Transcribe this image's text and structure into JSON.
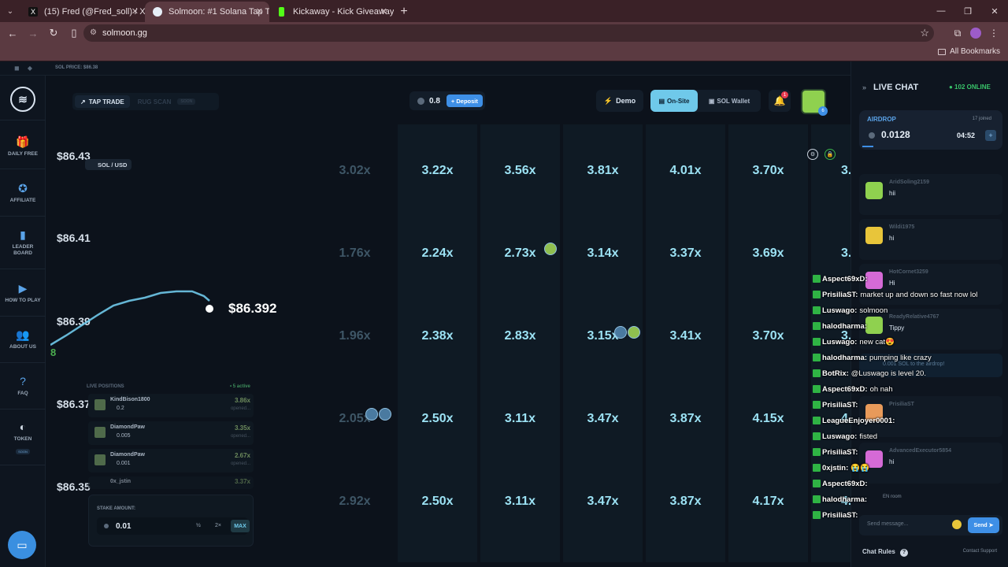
{
  "browser": {
    "tabs": [
      {
        "title": "(15) Fred (@Fred_soll) / X",
        "active": false,
        "icon": "x-icon"
      },
      {
        "title": "Solmoon: #1 Solana Tap Trading",
        "active": true,
        "icon": "solmoon-icon"
      },
      {
        "title": "Kickaway - Kick Giveaway Tool",
        "active": false,
        "icon": "kick-icon"
      }
    ],
    "url": "solmoon.gg",
    "bookmarks_label": "All Bookmarks"
  },
  "site": {
    "sol_price_text": "SOL PRICE: $86.38",
    "sidebar": [
      {
        "label": "DAILY FREE",
        "icon": "gift-icon"
      },
      {
        "label": "AFFILIATE",
        "icon": "affiliate-icon"
      },
      {
        "label": "LEADER BOARD",
        "icon": "leaderboard-icon"
      },
      {
        "label": "HOW TO PLAY",
        "icon": "play-icon"
      },
      {
        "label": "ABOUT US",
        "icon": "users-icon"
      },
      {
        "label": "FAQ",
        "icon": "question-icon"
      },
      {
        "label": "TOKEN",
        "icon": "token-icon",
        "badge": "SOON"
      }
    ],
    "header": {
      "tap_trade": "TAP TRADE",
      "rug_scan": "RUG SCAN",
      "rug_badge": "SOON",
      "balance": "0.8",
      "deposit": "+ Deposit",
      "demo": "Demo",
      "on_site": "On-Site",
      "sol_wallet": "SOL Wallet",
      "notif_count": "1",
      "user_level": "6"
    },
    "chart": {
      "pair": "SOL / USD",
      "price_labels": [
        "$86.43",
        "$86.41",
        "$86.39",
        "$86.37",
        "$86.35"
      ],
      "current_price": "$86.392",
      "edge_value": "8"
    },
    "grid_rows": [
      [
        "3.02x",
        "3.22x",
        "3.56x",
        "3.81x",
        "4.01x",
        "3.70x",
        "3."
      ],
      [
        "1.76x",
        "2.24x",
        "2.73x",
        "3.14x",
        "3.37x",
        "3.69x",
        "3."
      ],
      [
        "1.96x",
        "2.38x",
        "2.83x",
        "3.15x",
        "3.41x",
        "3.70x",
        "3."
      ],
      [
        "2.05x",
        "2.50x",
        "3.11x",
        "3.47x",
        "3.87x",
        "4.15x",
        "4."
      ],
      [
        "2.92x",
        "2.50x",
        "3.11x",
        "3.47x",
        "3.87x",
        "4.17x",
        "4."
      ]
    ],
    "live_positions": {
      "title": "LIVE POSITIONS",
      "active": "• 5 active",
      "rows": [
        {
          "name": "KindBison1800",
          "amount": "0.2",
          "mult": "3.86x",
          "status": "opened..."
        },
        {
          "name": "DiamondPaw",
          "amount": "0.005",
          "mult": "3.35x",
          "status": "opened..."
        },
        {
          "name": "DiamondPaw",
          "amount": "0.001",
          "mult": "2.67x",
          "status": "opened..."
        },
        {
          "name": "0x_jstin",
          "amount": "",
          "mult": "3.37x",
          "status": ""
        }
      ]
    },
    "stake": {
      "label": "STAKE AMOUNT:",
      "value": "0.01",
      "half": "½",
      "double": "2×",
      "max": "MAX"
    }
  },
  "live_chat": {
    "title": "LIVE CHAT",
    "online": "● 102 ONLINE",
    "airdrop": {
      "title": "AIRDROP",
      "joined": "17 joined",
      "value": "0.0128",
      "timer": "04:52",
      "plus": "+"
    },
    "messages": [
      {
        "user": "AridSoling2159",
        "text": "hii"
      },
      {
        "user": "Wildi1975",
        "text": "hi"
      },
      {
        "user": "HotCornet3259",
        "text": "Hi"
      },
      {
        "user": "ReadyRelative4767",
        "text": "Tippy"
      },
      {
        "user": "PrisiliaST",
        "text": ""
      },
      {
        "user": "AdvancedExecutor5854",
        "text": "hi"
      }
    ],
    "tip_notice": "0.001 SOL to the airdrop!",
    "room": "EN room",
    "input_placeholder": "Send message...",
    "send": "Send",
    "rules": "Chat Rules",
    "support": "Contact Support"
  },
  "overlay_chat": [
    {
      "user": "Aspect69xD:",
      "text": ""
    },
    {
      "user": "PrisiliaST:",
      "text": "market up and down so fast now lol"
    },
    {
      "user": "Luswago:",
      "text": "solmoon"
    },
    {
      "user": "halodharma:",
      "text": ""
    },
    {
      "user": "Luswago:",
      "text": "new cat😍"
    },
    {
      "user": "halodharma:",
      "text": "pumping like crazy"
    },
    {
      "user": "BotRix:",
      "text": "@Luswago is level 20."
    },
    {
      "user": "Aspect69xD:",
      "text": "oh nah"
    },
    {
      "user": "PrisiliaST:",
      "text": ""
    },
    {
      "user": "LeagueEnjoyer0001:",
      "text": ""
    },
    {
      "user": "Luswago:",
      "text": "fisted"
    },
    {
      "user": "PrisiliaST:",
      "text": ""
    },
    {
      "user": "0xjstin:",
      "text": "😭😭"
    },
    {
      "user": "Aspect69xD:",
      "text": ""
    },
    {
      "user": "halodharma:",
      "text": ""
    },
    {
      "user": "PrisiliaST:",
      "text": ""
    }
  ],
  "colors": {
    "accent": "#6fc9ea",
    "multiplier": "#9ce2f4",
    "online": "#39c46a",
    "brand_blue": "#3e8fe6"
  }
}
